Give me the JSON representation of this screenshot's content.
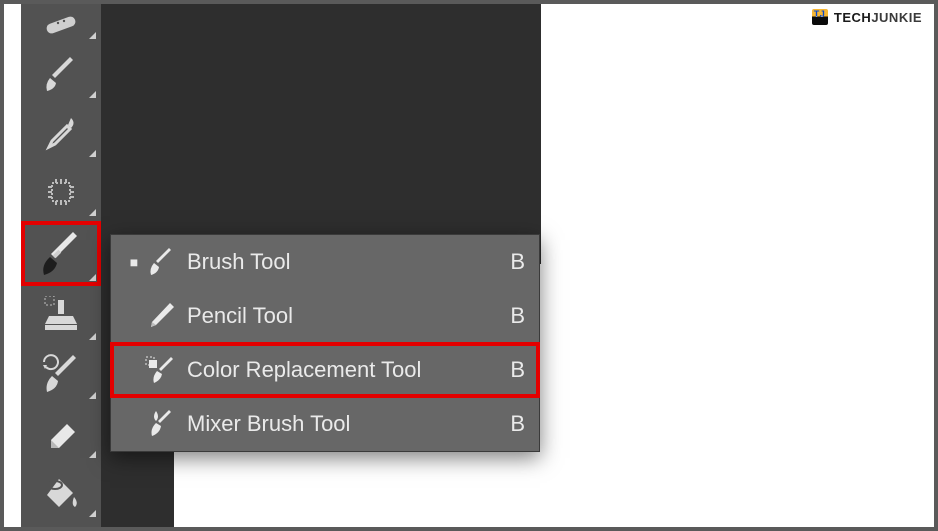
{
  "watermark": {
    "tech": "TECH",
    "junkie": "JUNKIE"
  },
  "toolbar": {
    "items": [
      {
        "name": "healing-brush-tool"
      },
      {
        "name": "brush-tool-prev"
      },
      {
        "name": "eyedropper-tool"
      },
      {
        "name": "processor-tool"
      },
      {
        "name": "brush-tool",
        "selected": true
      },
      {
        "name": "clone-stamp-tool"
      },
      {
        "name": "history-brush-tool"
      },
      {
        "name": "eraser-tool"
      },
      {
        "name": "paint-bucket-tool"
      }
    ]
  },
  "flyout": {
    "items": [
      {
        "label": "Brush Tool",
        "shortcut": "B",
        "active": true
      },
      {
        "label": "Pencil Tool",
        "shortcut": "B",
        "active": false
      },
      {
        "label": "Color Replacement Tool",
        "shortcut": "B",
        "active": false,
        "highlight": true
      },
      {
        "label": "Mixer Brush Tool",
        "shortcut": "B",
        "active": false
      }
    ]
  }
}
